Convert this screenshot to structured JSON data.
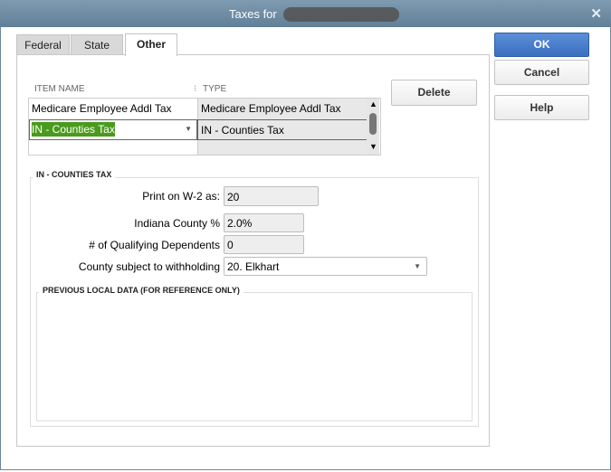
{
  "window": {
    "title": "Taxes for",
    "close_icon": "close-icon"
  },
  "tabs": [
    {
      "label": "Federal"
    },
    {
      "label": "State"
    },
    {
      "label": "Other",
      "active": true
    }
  ],
  "buttons": {
    "ok": "OK",
    "cancel": "Cancel",
    "help": "Help",
    "delete": "Delete"
  },
  "table": {
    "headers": [
      "ITEM NAME",
      "TYPE"
    ],
    "rows": [
      {
        "name": "Medicare Employee Addl Tax",
        "type": "Medicare Employee Addl Tax"
      },
      {
        "name": "IN - Counties Tax",
        "type": "IN - Counties Tax",
        "selected": true
      }
    ]
  },
  "details": {
    "title": "IN - COUNTIES TAX",
    "fields": [
      {
        "label": "Print on W-2 as:",
        "value": "20"
      },
      {
        "label": "Indiana County %",
        "value": "2.0%"
      },
      {
        "label": "# of Qualifying Dependents",
        "value": "0"
      },
      {
        "label": "County subject to withholding",
        "value": "20. Elkhart"
      }
    ],
    "previous_title": "PREVIOUS LOCAL DATA (FOR REFERENCE ONLY)"
  },
  "colors": {
    "accent": "#3b6fc0",
    "selection": "#4a9a1c",
    "titlebar": "#6f8ca3"
  }
}
